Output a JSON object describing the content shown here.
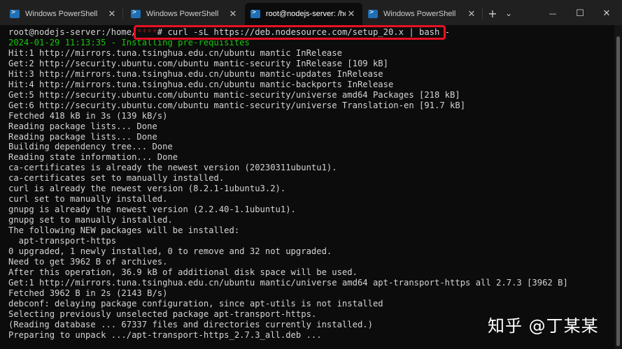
{
  "tabs": [
    {
      "label": "Windows PowerShell",
      "active": false
    },
    {
      "label": "Windows PowerShell",
      "active": false
    },
    {
      "label": "root@nodejs-server: /hom",
      "active": true
    },
    {
      "label": "Windows PowerShell",
      "active": false
    }
  ],
  "toolbar": {
    "new_tab": "+",
    "dropdown": "⌄",
    "minimize": "—",
    "maximize": "☐",
    "close": "✕"
  },
  "prompt": {
    "text": "root@nodejs-server:/home/",
    "obscured": "****",
    "command": "# curl -sL https://deb.nodesource.com/setup_20.x | bash -"
  },
  "output": [
    "2024-01-29 11:13:35 - Installing pre-requisites",
    "Hit:1 http://mirrors.tuna.tsinghua.edu.cn/ubuntu mantic InRelease",
    "Get:2 http://security.ubuntu.com/ubuntu mantic-security InRelease [109 kB]",
    "Hit:3 http://mirrors.tuna.tsinghua.edu.cn/ubuntu mantic-updates InRelease",
    "Hit:4 http://mirrors.tuna.tsinghua.edu.cn/ubuntu mantic-backports InRelease",
    "Get:5 http://security.ubuntu.com/ubuntu mantic-security/universe amd64 Packages [218 kB]",
    "Get:6 http://security.ubuntu.com/ubuntu mantic-security/universe Translation-en [91.7 kB]",
    "Fetched 418 kB in 3s (139 kB/s)",
    "Reading package lists... Done",
    "Reading package lists... Done",
    "Building dependency tree... Done",
    "Reading state information... Done",
    "ca-certificates is already the newest version (20230311ubuntu1).",
    "ca-certificates set to manually installed.",
    "curl is already the newest version (8.2.1-1ubuntu3.2).",
    "curl set to manually installed.",
    "gnupg is already the newest version (2.2.40-1.1ubuntu1).",
    "gnupg set to manually installed.",
    "The following NEW packages will be installed:",
    "  apt-transport-https",
    "0 upgraded, 1 newly installed, 0 to remove and 32 not upgraded.",
    "Need to get 3962 B of archives.",
    "After this operation, 36.9 kB of additional disk space will be used.",
    "Get:1 http://mirrors.tuna.tsinghua.edu.cn/ubuntu mantic/universe amd64 apt-transport-https all 2.7.3 [3962 B]",
    "Fetched 3962 B in 2s (2143 B/s)",
    "debconf: delaying package configuration, since apt-utils is not installed",
    "Selecting previously unselected package apt-transport-https.",
    "(Reading database ... 67337 files and directories currently installed.)",
    "Preparing to unpack .../apt-transport-https_2.7.3_all.deb ..."
  ],
  "watermark": "知乎 @丁某某",
  "colors": {
    "terminal_bg": "#0c0c0c",
    "tabbar_bg": "#202020",
    "text": "#d4d4d4",
    "green": "#16c60c",
    "highlight": "#e81123"
  }
}
